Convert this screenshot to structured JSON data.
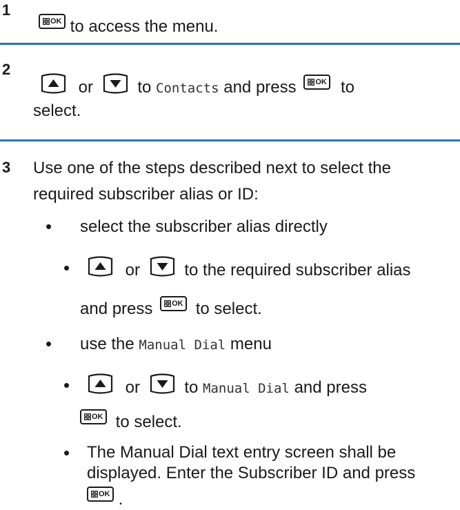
{
  "steps": [
    {
      "number": "1",
      "text": "to access the menu."
    },
    {
      "number": "2",
      "or": "or",
      "to": "to",
      "target": "Contacts",
      "and_press": "and press",
      "to_end": "to",
      "line2": "select."
    },
    {
      "number": "3",
      "line1": "Use one of the steps described next to select the",
      "line2": "required subscriber alias or ID:",
      "options": [
        {
          "text": "select the subscriber alias directly",
          "sub": {
            "or": "or",
            "line1_tail": "to the required subscriber alias",
            "line2_a": "and press",
            "line2_b": "to select."
          }
        },
        {
          "text_a": "use the",
          "menu": "Manual Dial",
          "text_b": "menu",
          "sub1": {
            "or": "or",
            "to": "to",
            "target": "Manual Dial",
            "tail": "and press",
            "line2": "to select."
          },
          "sub2": {
            "line1": "The Manual Dial text entry screen shall be",
            "line2": "displayed. Enter the Subscriber ID and press",
            "line3": "."
          }
        }
      ]
    }
  ],
  "keys": {
    "ok_label": "OK",
    "up_icon": "up-arrow-key-icon",
    "down_icon": "down-arrow-key-icon",
    "menu_ok_icon": "menu-ok-key-icon"
  },
  "colors": {
    "divider": "#2b73b6",
    "text": "#1a1a1a"
  }
}
